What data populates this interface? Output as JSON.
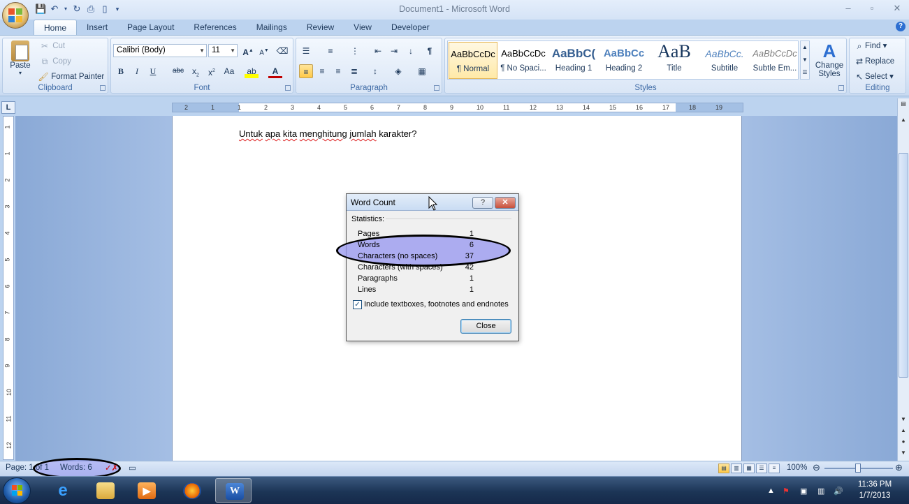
{
  "window": {
    "title": "Document1 - Microsoft Word",
    "controls": [
      "–",
      "▫",
      "✕"
    ]
  },
  "tabs": [
    "Home",
    "Insert",
    "Page Layout",
    "References",
    "Mailings",
    "Review",
    "View",
    "Developer"
  ],
  "ribbon": {
    "clipboard": {
      "label": "Clipboard",
      "paste": "Paste",
      "cut": "Cut",
      "copy": "Copy",
      "format_painter": "Format Painter"
    },
    "font": {
      "label": "Font",
      "family": "Calibri (Body)",
      "size": "11"
    },
    "paragraph": {
      "label": "Paragraph"
    },
    "styles": {
      "label": "Styles",
      "tiles": [
        {
          "preview": "AaBbCcDc",
          "name": "¶ Normal"
        },
        {
          "preview": "AaBbCcDc",
          "name": "¶ No Spaci..."
        },
        {
          "preview": "AaBbC(",
          "name": "Heading 1"
        },
        {
          "preview": "AaBbCc",
          "name": "Heading 2"
        },
        {
          "preview": "AaB",
          "name": "Title"
        },
        {
          "preview": "AaBbCc.",
          "name": "Subtitle"
        },
        {
          "preview": "AaBbCcDc",
          "name": "Subtle Em..."
        }
      ],
      "change_styles": "Change Styles"
    },
    "editing": {
      "label": "Editing",
      "find": "Find",
      "replace": "Replace",
      "select": "Select"
    }
  },
  "ruler": {
    "ticks": [
      "2",
      "1",
      "1",
      "2",
      "3",
      "4",
      "5",
      "6",
      "7",
      "8",
      "9",
      "10",
      "11",
      "12",
      "13",
      "14",
      "15",
      "16",
      "17",
      "18",
      "19"
    ],
    "vticks": [
      "1",
      "1",
      "2",
      "3",
      "4",
      "5",
      "6",
      "7",
      "8",
      "9",
      "10",
      "11",
      "12"
    ]
  },
  "document": {
    "words": [
      {
        "text": "Untuk",
        "misspelled": true
      },
      {
        "text": "apa",
        "misspelled": true
      },
      {
        "text": "kita",
        "misspelled": true
      },
      {
        "text": "menghitung",
        "misspelled": true
      },
      {
        "text": "jumlah",
        "misspelled": true
      },
      {
        "text": "karakter?",
        "misspelled": false
      }
    ]
  },
  "dialog": {
    "title": "Word Count",
    "help": "?",
    "section": "Statistics:",
    "stats": [
      {
        "label": "Pages",
        "value": "1"
      },
      {
        "label": "Words",
        "value": "6"
      },
      {
        "label": "Characters (no spaces)",
        "value": "37"
      },
      {
        "label": "Characters (with spaces)",
        "value": "42"
      },
      {
        "label": "Paragraphs",
        "value": "1"
      },
      {
        "label": "Lines",
        "value": "1"
      }
    ],
    "include_checkbox": {
      "label": "Include textboxes, footnotes and endnotes",
      "checked": true
    },
    "close_button": "Close"
  },
  "status": {
    "page": "Page: 1 of 1",
    "words": "Words: 6",
    "zoom": "100%"
  },
  "taskbar": {
    "time": "11:36 PM",
    "date": "1/7/2013"
  }
}
